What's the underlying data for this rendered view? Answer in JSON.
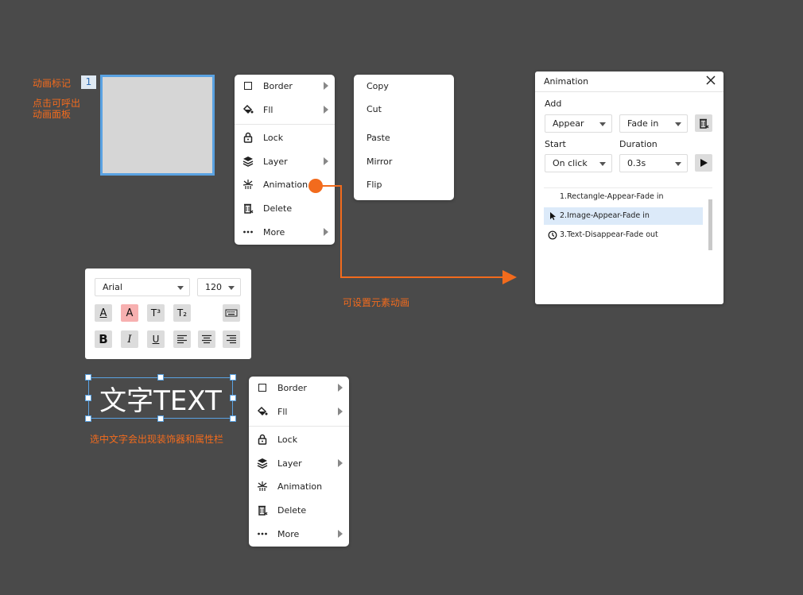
{
  "annotations": {
    "anim_marker_label": "动画标记",
    "anim_marker_badge": "1",
    "click_open_line1": "点击可呼出",
    "click_open_line2": "动画面板",
    "set_anim_label": "可设置元素动画",
    "select_text_label": "选中文字会出现装饰器和属性栏"
  },
  "context_menu": {
    "items": [
      {
        "label": "Border",
        "icon": "square-border-icon",
        "submenu": true
      },
      {
        "label": "Fll",
        "icon": "paint-bucket-icon",
        "submenu": true
      },
      {
        "label": "Lock",
        "icon": "lock-icon",
        "submenu": false
      },
      {
        "label": "Layer",
        "icon": "layers-icon",
        "submenu": true
      },
      {
        "label": "Animation",
        "icon": "firework-icon",
        "submenu": false
      },
      {
        "label": "Delete",
        "icon": "trash-icon",
        "submenu": false
      },
      {
        "label": "More",
        "icon": "ellipsis-icon",
        "submenu": true
      }
    ]
  },
  "edit_menu": {
    "items": [
      "Copy",
      "Cut",
      "Paste",
      "Mirror",
      "Flip"
    ]
  },
  "animation_panel": {
    "title": "Animation",
    "add_label": "Add",
    "effect_value": "Appear",
    "transition_value": "Fade in",
    "start_label": "Start",
    "duration_label": "Duration",
    "start_value": "On click",
    "duration_value": "0.3s",
    "list": [
      {
        "label": "1.Rectangle-Appear-Fade in",
        "icon": "",
        "selected": false
      },
      {
        "label": "2.Image-Appear-Fade in",
        "icon": "cursor-icon",
        "selected": true
      },
      {
        "label": "3.Text-Disappear-Fade out",
        "icon": "clock-icon",
        "selected": false
      }
    ]
  },
  "text_toolbar": {
    "font_value": "Arial",
    "size_value": "120",
    "font_color_glyph": "A",
    "highlight_glyph": "A",
    "superscript_glyph": "T³",
    "subscript_glyph": "T₂",
    "bold_glyph": "B",
    "italic_glyph": "I",
    "underline_glyph": "U"
  },
  "text_element": {
    "content": "文字TEXT"
  },
  "colors": {
    "accent": "#f26b1d",
    "selection": "#5aa2e2",
    "background": "#4a4a4a"
  }
}
